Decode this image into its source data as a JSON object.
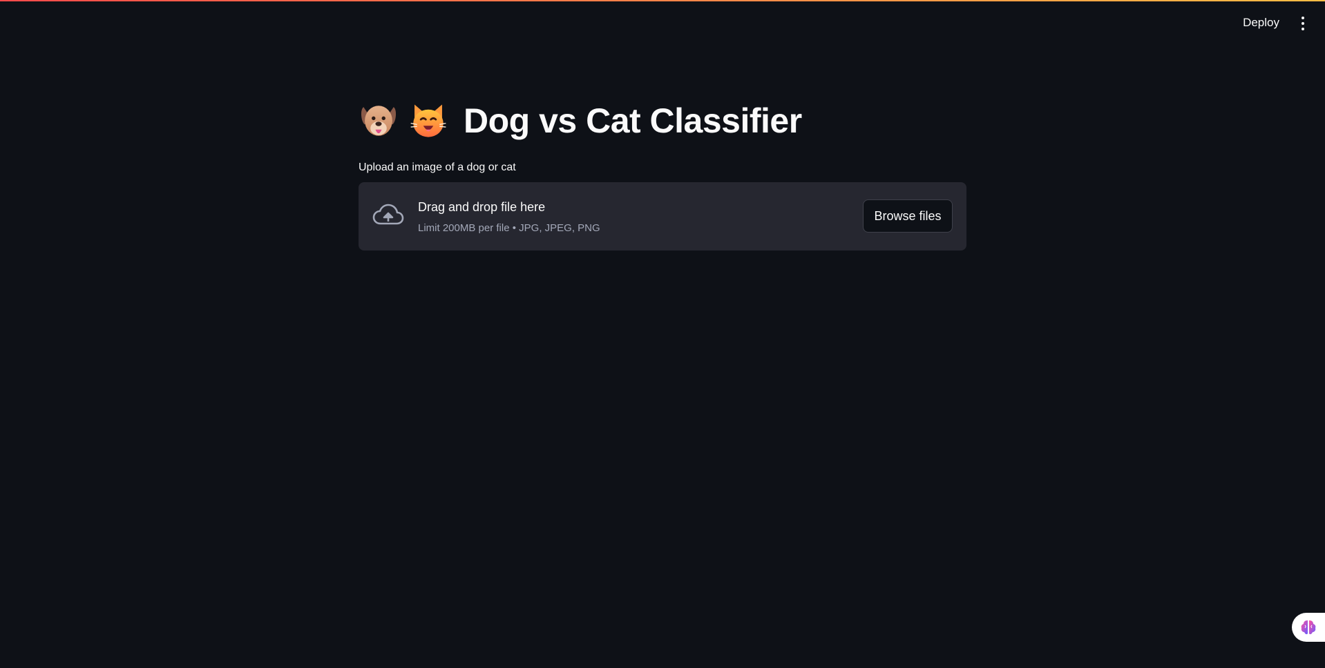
{
  "header": {
    "deploy_label": "Deploy",
    "menu_icon": "kebab-vertical-icon"
  },
  "main": {
    "title": "Dog vs Cat Classifier",
    "title_icons": [
      "dog-face-icon",
      "cat-face-icon"
    ],
    "uploader": {
      "label": "Upload an image of a dog or cat",
      "dropzone_title": "Drag and drop file here",
      "dropzone_subtitle": "Limit 200MB per file • JPG, JPEG, PNG",
      "browse_label": "Browse files",
      "icon": "cloud-upload-icon"
    }
  },
  "floating": {
    "icon": "brain-icon"
  },
  "colors": {
    "background": "#0e1117",
    "dropzone": "#262730",
    "accent_start": "#ff4b4b",
    "accent_end": "#ffbd45"
  }
}
